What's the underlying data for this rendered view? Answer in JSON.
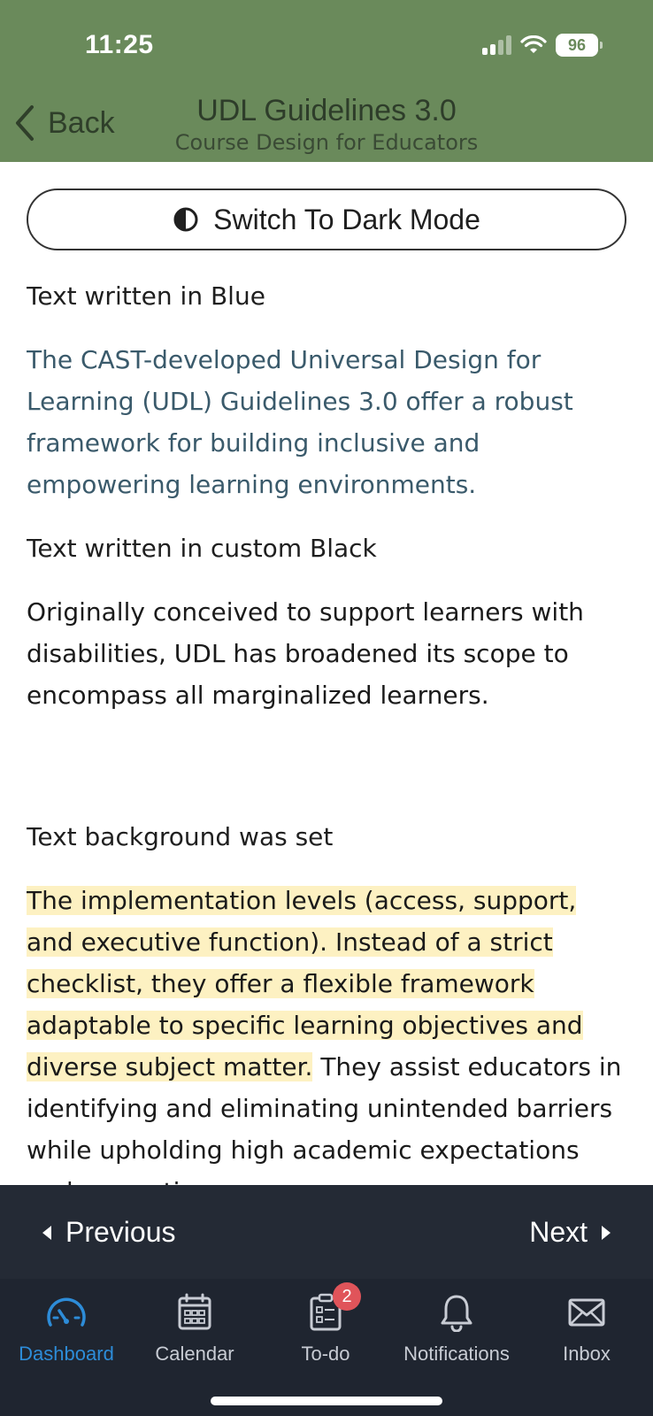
{
  "status_bar": {
    "time": "11:25",
    "battery": "96"
  },
  "header": {
    "back_label": "Back",
    "title": "UDL Guidelines 3.0",
    "subtitle": "Course Design for Educators",
    "background_color": "#6a8a5b"
  },
  "toggle": {
    "label": "Switch To Dark Mode",
    "icon": "half-circle-contrast-icon"
  },
  "content": {
    "section1_label": "Text written in Blue",
    "section1_text": "The CAST-developed Universal Design for Learning (UDL) Guidelines 3.0 offer a robust framework for building inclusive and empowering learning environments.",
    "section2_label": "Text written in custom Black",
    "section2_text": "Originally conceived to support learners with disabilities, UDL has broadened its scope to encompass all marginalized learners.",
    "section3_label": "Text background was set",
    "section3_highlighted": "The implementation levels (access, support, and executive function). Instead of a strict checklist, they offer a flexible framework adaptable to specific learning objectives and diverse subject matter.",
    "section3_rest": " They assist educators in identifying and eliminating unintended barriers while upholding high academic expectations and respecting",
    "blue_color": "#3a5a6b",
    "highlight_color": "#fdf1c2"
  },
  "pager": {
    "previous_label": "Previous",
    "next_label": "Next"
  },
  "tabs": [
    {
      "label": "Dashboard",
      "icon": "dashboard-gauge-icon",
      "active": true
    },
    {
      "label": "Calendar",
      "icon": "calendar-icon",
      "active": false
    },
    {
      "label": "To-do",
      "icon": "todo-clipboard-icon",
      "active": false,
      "badge": "2"
    },
    {
      "label": "Notifications",
      "icon": "bell-icon",
      "active": false
    },
    {
      "label": "Inbox",
      "icon": "envelope-icon",
      "active": false
    }
  ]
}
